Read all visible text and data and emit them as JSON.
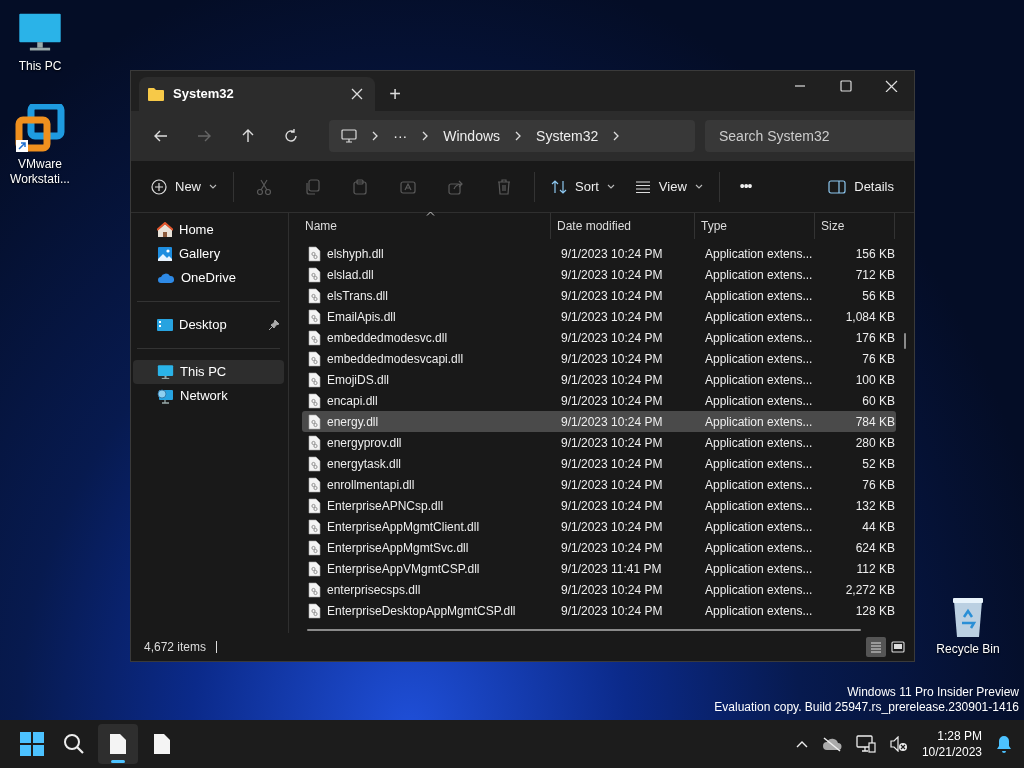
{
  "desktop_icons": [
    {
      "label": "This PC"
    },
    {
      "label": "VMware Workstati..."
    },
    {
      "label": "Recycle Bin"
    }
  ],
  "window": {
    "tab_title": "System32",
    "new_tab": "+",
    "breadcrumb": [
      "···",
      "Windows",
      "System32"
    ],
    "search": {
      "placeholder": "Search System32"
    },
    "toolbar": [
      {
        "kind": "menu",
        "label": "New",
        "disabled": false
      },
      {
        "kind": "icon",
        "disabled": true
      },
      {
        "kind": "icon",
        "disabled": true
      },
      {
        "kind": "icon",
        "disabled": true
      },
      {
        "kind": "icon",
        "disabled": true
      },
      {
        "kind": "icon",
        "disabled": true
      },
      {
        "kind": "icon",
        "disabled": true
      },
      {
        "kind": "menu",
        "label": "Sort",
        "disabled": false
      },
      {
        "kind": "menu",
        "label": "View",
        "disabled": false
      },
      {
        "kind": "more",
        "label": "•••",
        "disabled": false
      },
      {
        "kind": "details",
        "label": "Details",
        "disabled": false
      }
    ],
    "sidebar": [
      {
        "label": "Home",
        "selected": false,
        "pinned": false
      },
      {
        "label": "Gallery",
        "selected": false,
        "pinned": false
      },
      {
        "label": "OneDrive",
        "selected": false,
        "pinned": false
      },
      {
        "label": "Desktop",
        "selected": false,
        "pinned": true
      },
      {
        "label": "This PC",
        "selected": true,
        "pinned": false
      },
      {
        "label": "Network",
        "selected": false,
        "pinned": false
      }
    ],
    "columns": [
      "Name",
      "Date modified",
      "Type",
      "Size"
    ],
    "rows": [
      {
        "name": "elshyph.dll",
        "date": "9/1/2023 10:24 PM",
        "type": "Application extens...",
        "size": "156 KB",
        "selected": false
      },
      {
        "name": "elslad.dll",
        "date": "9/1/2023 10:24 PM",
        "type": "Application extens...",
        "size": "712 KB",
        "selected": false
      },
      {
        "name": "elsTrans.dll",
        "date": "9/1/2023 10:24 PM",
        "type": "Application extens...",
        "size": "56 KB",
        "selected": false
      },
      {
        "name": "EmailApis.dll",
        "date": "9/1/2023 10:24 PM",
        "type": "Application extens...",
        "size": "1,084 KB",
        "selected": false
      },
      {
        "name": "embeddedmodesvc.dll",
        "date": "9/1/2023 10:24 PM",
        "type": "Application extens...",
        "size": "176 KB",
        "selected": false
      },
      {
        "name": "embeddedmodesvcapi.dll",
        "date": "9/1/2023 10:24 PM",
        "type": "Application extens...",
        "size": "76 KB",
        "selected": false
      },
      {
        "name": "EmojiDS.dll",
        "date": "9/1/2023 10:24 PM",
        "type": "Application extens...",
        "size": "100 KB",
        "selected": false
      },
      {
        "name": "encapi.dll",
        "date": "9/1/2023 10:24 PM",
        "type": "Application extens...",
        "size": "60 KB",
        "selected": false
      },
      {
        "name": "energy.dll",
        "date": "9/1/2023 10:24 PM",
        "type": "Application extens...",
        "size": "784 KB",
        "selected": true
      },
      {
        "name": "energyprov.dll",
        "date": "9/1/2023 10:24 PM",
        "type": "Application extens...",
        "size": "280 KB",
        "selected": false
      },
      {
        "name": "energytask.dll",
        "date": "9/1/2023 10:24 PM",
        "type": "Application extens...",
        "size": "52 KB",
        "selected": false
      },
      {
        "name": "enrollmentapi.dll",
        "date": "9/1/2023 10:24 PM",
        "type": "Application extens...",
        "size": "76 KB",
        "selected": false
      },
      {
        "name": "EnterpriseAPNCsp.dll",
        "date": "9/1/2023 10:24 PM",
        "type": "Application extens...",
        "size": "132 KB",
        "selected": false
      },
      {
        "name": "EnterpriseAppMgmtClient.dll",
        "date": "9/1/2023 10:24 PM",
        "type": "Application extens...",
        "size": "44 KB",
        "selected": false
      },
      {
        "name": "EnterpriseAppMgmtSvc.dll",
        "date": "9/1/2023 10:24 PM",
        "type": "Application extens...",
        "size": "624 KB",
        "selected": false
      },
      {
        "name": "EnterpriseAppVMgmtCSP.dll",
        "date": "9/1/2023 11:41 PM",
        "type": "Application extens...",
        "size": "112 KB",
        "selected": false
      },
      {
        "name": "enterprisecsps.dll",
        "date": "9/1/2023 10:24 PM",
        "type": "Application extens...",
        "size": "2,272 KB",
        "selected": false
      },
      {
        "name": "EnterpriseDesktopAppMgmtCSP.dll",
        "date": "9/1/2023 10:24 PM",
        "type": "Application extens...",
        "size": "128 KB",
        "selected": false
      }
    ],
    "status": "4,672 items",
    "view_modes": [
      {
        "selected": true
      },
      {
        "selected": false
      }
    ]
  },
  "watermark": [
    "Windows 11 Pro Insider Preview",
    "Evaluation copy. Build 25947.rs_prerelease.230901-1416"
  ],
  "taskbar": {
    "apps": [
      {
        "active": true
      },
      {
        "active": false
      }
    ],
    "time": "1:28 PM",
    "date": "10/21/2023"
  }
}
